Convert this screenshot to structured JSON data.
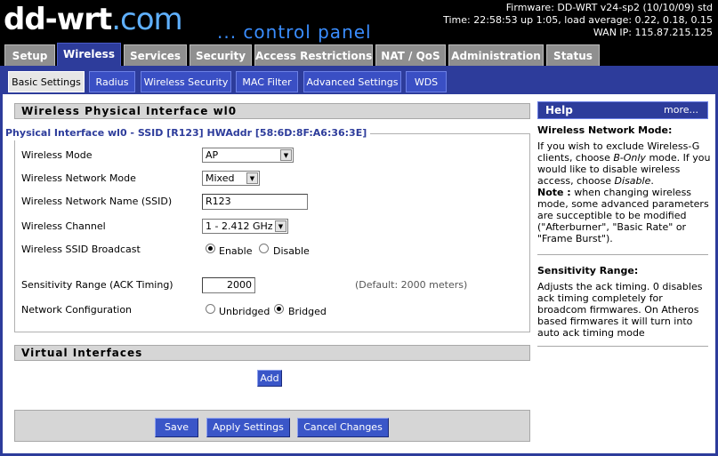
{
  "header": {
    "logo_text": "dd-wrt",
    "logo_com": ".com",
    "control_panel": "... control panel",
    "firmware": "Firmware: DD-WRT v24-sp2 (10/10/09) std",
    "time": "Time: 22:58:53 up 1:05, load average: 0.22, 0.18, 0.15",
    "wan_ip": "WAN IP: 115.87.215.125"
  },
  "main_tabs": [
    "Setup",
    "Wireless",
    "Services",
    "Security",
    "Access Restrictions",
    "NAT / QoS",
    "Administration",
    "Status"
  ],
  "sub_tabs": [
    "Basic Settings",
    "Radius",
    "Wireless Security",
    "MAC Filter",
    "Advanced Settings",
    "WDS"
  ],
  "physical": {
    "section_title": "Wireless Physical Interface wl0",
    "iface_title": "Physical Interface wl0 - SSID [R123] HWAddr [58:6D:8F:A6:36:3E]",
    "mode_label": "Wireless Mode",
    "mode_value": "AP",
    "net_mode_label": "Wireless Network Mode",
    "net_mode_value": "Mixed",
    "ssid_label": "Wireless Network Name (SSID)",
    "ssid_value": "R123",
    "channel_label": "Wireless Channel",
    "channel_value": "1 - 2.412 GHz",
    "broadcast_label": "Wireless SSID Broadcast",
    "broadcast_enable": "Enable",
    "broadcast_disable": "Disable",
    "ack_label": "Sensitivity Range (ACK Timing)",
    "ack_value": "2000",
    "ack_default": "(Default: 2000 meters)",
    "netconf_label": "Network Configuration",
    "netconf_unbridged": "Unbridged",
    "netconf_bridged": "Bridged"
  },
  "virtual": {
    "section_title": "Virtual Interfaces",
    "add_label": "Add"
  },
  "buttons": {
    "save": "Save",
    "apply": "Apply Settings",
    "cancel": "Cancel Changes"
  },
  "help": {
    "title": "Help",
    "more": "more...",
    "section1_title": "Wireless Network Mode:",
    "section1_text_a": "If you wish to exclude Wireless-G clients, choose ",
    "section1_text_b_italic": "B-Only",
    "section1_text_c": " mode. If you would like to disable wireless access, choose ",
    "section1_text_d_italic": "Disable",
    "section1_text_e": ".",
    "note_label": "Note :",
    "note_text": " when changing wireless mode, some advanced parameters are succeptible to be modified (\"Afterburner\", \"Basic Rate\" or \"Frame Burst\").",
    "section2_title": "Sensitivity Range:",
    "section2_text": "Adjusts the ack timing. 0 disables ack timing completely for broadcom firmwares. On Atheros based firmwares it will turn into auto ack timing mode"
  },
  "colors": {
    "accent": "#2d3c9b",
    "tab_gray": "#8f8f8f",
    "button_blue": "#3a56c8"
  }
}
